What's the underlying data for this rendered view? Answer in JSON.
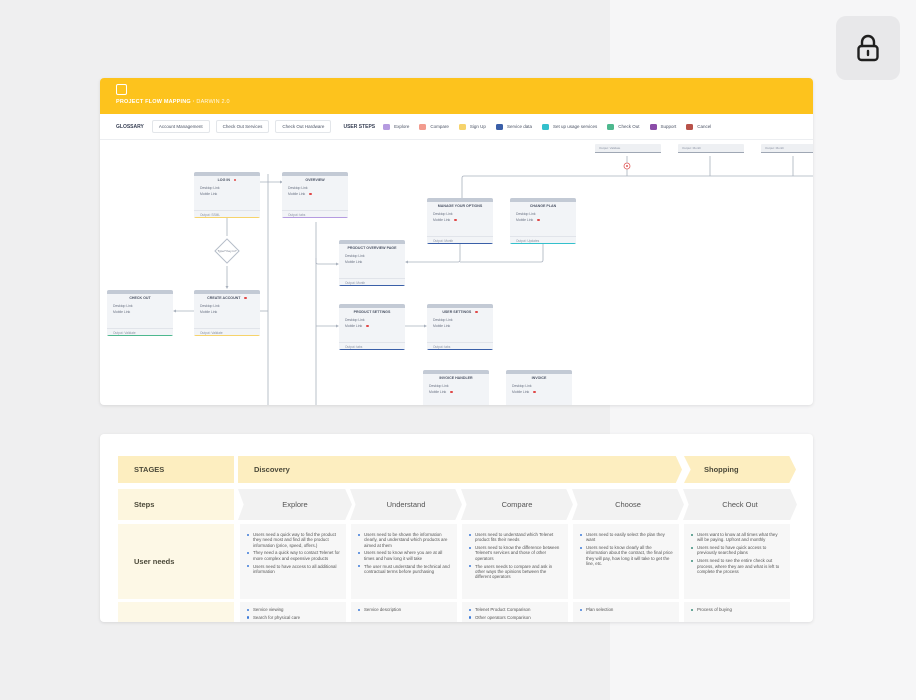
{
  "flow_map": {
    "header": {
      "title": "PROJECT FLOW MAPPING",
      "subtitle": "DARWIN 2.0"
    },
    "toolbar": {
      "glossary_label": "GLOSSARY",
      "buttons": [
        "Account Management",
        "Check Out Services",
        "Check Out Hardware"
      ],
      "user_steps_label": "USER STEPS",
      "steps": [
        {
          "label": "Explore",
          "color": "#b59be0"
        },
        {
          "label": "Compare",
          "color": "#f29b8e"
        },
        {
          "label": "Sign Up",
          "color": "#f6d36b"
        },
        {
          "label": "Service data",
          "color": "#3a5fa8"
        },
        {
          "label": "Set up usage services",
          "color": "#33c0cc"
        },
        {
          "label": "Check Out",
          "color": "#4db88e"
        },
        {
          "label": "Support",
          "color": "#8b4da8"
        },
        {
          "label": "Cancel",
          "color": "#b8524a"
        }
      ]
    },
    "nodes": {
      "login": {
        "title": "LOG IN",
        "link1": "Desktop Link",
        "link2": "Mobile Link",
        "footer": "Output: SSML"
      },
      "overview": {
        "title": "OVERVIEW",
        "link1": "Desktop Link",
        "link2": "Mobile Link",
        "footer": "Output: tabs"
      },
      "manage_options": {
        "title": "MANAGE YOUR OPTIONS",
        "link1": "Desktop Link",
        "link2": "Mobile Link",
        "footer": "Output: Month"
      },
      "change_plan": {
        "title": "CHANGE PLAN",
        "link1": "Desktop Link",
        "link2": "Mobile Link",
        "footer": "Output: Updates"
      },
      "product_overview": {
        "title": "PRODUCT OVERVIEW PAGE",
        "link1": "Desktop Link",
        "link2": "Mobile Link",
        "footer": "Output: Month"
      },
      "check_out": {
        "title": "CHECK OUT",
        "link1": "Desktop Link",
        "link2": "Mobile Link",
        "footer": "Output: Validate"
      },
      "create_account": {
        "title": "CREATE ACCOUNT",
        "link1": "Desktop Link",
        "link2": "Mobile Link",
        "footer": "Output: Validate"
      },
      "product_settings": {
        "title": "PRODUCT SETTINGS",
        "link1": "Desktop Link",
        "link2": "Mobile Link",
        "footer": "Output: tabs"
      },
      "user_settings": {
        "title": "USER SETTINGS",
        "link1": "Desktop Link",
        "link2": "Mobile Link",
        "footer": "Output: tabs"
      },
      "invoice_handler": {
        "title": "INVOICE HANDLER",
        "link1": "Desktop Link",
        "link2": "Mobile Link"
      },
      "invoice": {
        "title": "INVOICE",
        "link1": "Desktop Link",
        "link2": "Mobile Link"
      }
    },
    "stubs": [
      "Output: Validate",
      "Output: Month",
      "Output: Month"
    ],
    "decision": "Type? Key in?"
  },
  "journey": {
    "row_labels": {
      "stages": "STAGES",
      "steps": "Steps",
      "user_needs": "User needs"
    },
    "stages": [
      "Discovery",
      "Shopping"
    ],
    "steps": [
      "Explore",
      "Understand",
      "Compare",
      "Choose",
      "Check Out"
    ],
    "user_needs": [
      [
        "Users need a quick way to find the product they need most and find all the product information (price, speed, offers.)",
        "They need a quick way to contact Telenet for more complex and expensive products",
        "Users need to have access to all additional information"
      ],
      [
        "Users need to be shown the information clearly, and understand which products are aimed at them",
        "Users need to know where you are at all times and how long it will take",
        "The user must understand the technical and contractual terms before purchasing"
      ],
      [
        "Users need to understand which Telenet product fits their needs",
        "Users need to know the difference between Telenet's services and those of other operators",
        "The users needs to compare and ask in other ways the opinions between the different operators"
      ],
      [
        "Users need to easily select the plan they want",
        "Users need to know clearly all the information about the contract, the final price they will pay, how long it will take to get the line, etc."
      ],
      [
        "Users want to know at all times what they will be paying. Upfront and monthly",
        "Users need to have quick access to previously searched plans",
        "Users need to see the entire check out process, where they are and what is left to complete the process"
      ]
    ],
    "touchpoints": [
      [
        "Service viewing",
        "Search for physical care"
      ],
      [
        "Service description"
      ],
      [
        "Telenet Product Comparison",
        "Other operators Comparison"
      ],
      [
        "Plan selection"
      ],
      [
        "Process of buying"
      ]
    ]
  },
  "icons": {
    "lock": "lock-icon"
  }
}
